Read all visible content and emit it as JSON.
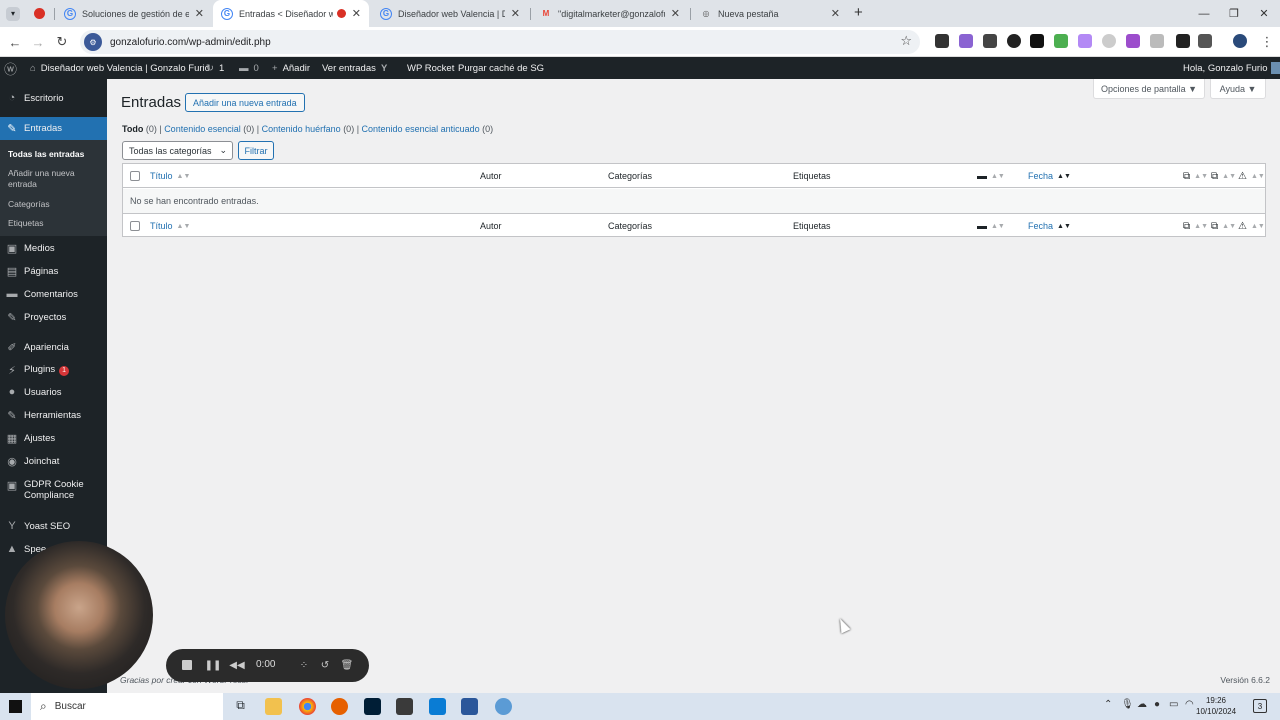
{
  "browser": {
    "tabs": [
      {
        "title": "Soluciones de gestión de etiqu",
        "active": false,
        "fav": "G"
      },
      {
        "title": "Entradas < Diseñador web",
        "active": true,
        "fav": "G"
      },
      {
        "title": "Diseñador web Valencia | Dise",
        "active": false,
        "fav": "G"
      },
      {
        "title": "\"digitalmarketer@gonzalofurio",
        "active": false,
        "fav": "M"
      },
      {
        "title": "Nueva pestaña",
        "active": false,
        "fav": "◎"
      }
    ],
    "new_tab": "+",
    "url": "gonzalofurio.com/wp-admin/edit.php"
  },
  "adminbar": {
    "site_name": "Diseñador web Valencia | Gonzalo Furió",
    "updates": "1",
    "comments": "0",
    "add_new": "Añadir",
    "view_posts": "Ver entradas",
    "wp_rocket": "WP Rocket",
    "purge": "Purgar caché de SG",
    "greeting": "Hola, Gonzalo Furio"
  },
  "sidebar": {
    "items": [
      {
        "label": "Escritorio",
        "icon": "dashboard-icon"
      },
      {
        "label": "Entradas",
        "icon": "pin-icon",
        "current": true
      },
      {
        "label": "Medios",
        "icon": "media-icon"
      },
      {
        "label": "Páginas",
        "icon": "pages-icon"
      },
      {
        "label": "Comentarios",
        "icon": "comments-icon"
      },
      {
        "label": "Proyectos",
        "icon": "projects-icon"
      },
      {
        "label": "Apariencia",
        "icon": "appearance-icon"
      },
      {
        "label": "Plugins",
        "icon": "plugins-icon",
        "badge": "1"
      },
      {
        "label": "Usuarios",
        "icon": "users-icon"
      },
      {
        "label": "Herramientas",
        "icon": "tools-icon"
      },
      {
        "label": "Ajustes",
        "icon": "settings-icon"
      },
      {
        "label": "Joinchat",
        "icon": "chat-icon"
      },
      {
        "label": "GDPR Cookie Compliance",
        "icon": "gdpr-icon"
      },
      {
        "label": "Yoast SEO",
        "icon": "yoast-icon"
      },
      {
        "label": "Spee...",
        "icon": "speed-icon"
      }
    ],
    "submenu": [
      {
        "label": "Todas las entradas",
        "current": true
      },
      {
        "label": "Añadir una nueva entrada"
      },
      {
        "label": "Categorías"
      },
      {
        "label": "Etiquetas"
      }
    ]
  },
  "screen_options": "Opciones de pantalla ▼",
  "help": "Ayuda ▼",
  "page": {
    "title": "Entradas",
    "add_new": "Añadir una nueva entrada",
    "views": [
      {
        "label": "Todo",
        "count": "(0)"
      },
      {
        "label": "Contenido esencial",
        "count": "(0)"
      },
      {
        "label": "Contenido huérfano",
        "count": "(0)"
      },
      {
        "label": "Contenido esencial anticuado",
        "count": "(0)"
      }
    ],
    "category_filter": "Todas las categorías",
    "filter_button": "Filtrar",
    "columns": {
      "title": "Título",
      "author": "Autor",
      "categories": "Categorías",
      "tags": "Etiquetas",
      "date": "Fecha"
    },
    "empty": "No se han encontrado entradas."
  },
  "footer": {
    "thanks": "Gracias por crear con WordPress.",
    "version": "Versión 6.6.2"
  },
  "recorder": {
    "time": "0:00"
  },
  "taskbar": {
    "search": "Buscar",
    "time": "19:26",
    "date": "10/10/2024",
    "notifications": "3"
  }
}
